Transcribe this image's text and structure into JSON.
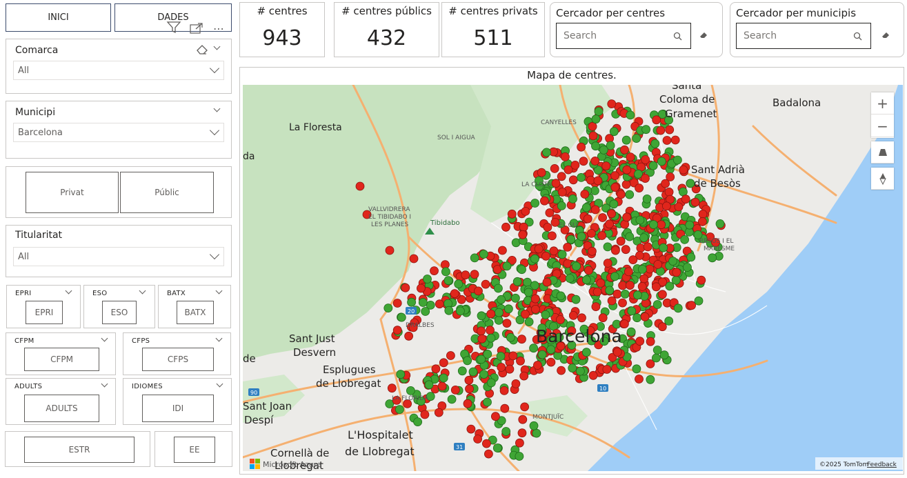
{
  "nav": {
    "inici": "INICI",
    "dades": "DADES"
  },
  "slicers": {
    "comarca": {
      "title": "Comarca",
      "value": "All"
    },
    "municipi": {
      "title": "Municipi",
      "value": "Barcelona"
    },
    "titularitat": {
      "title": "Titularitat",
      "value": "All"
    }
  },
  "tipus_buttons": {
    "privat": "Privat",
    "public": "Públic"
  },
  "levels": [
    {
      "title": "EPRI",
      "button": "EPRI"
    },
    {
      "title": "ESO",
      "button": "ESO"
    },
    {
      "title": "BATX",
      "button": "BATX"
    },
    {
      "title": "CFPM",
      "button": "CFPM"
    },
    {
      "title": "CFPS",
      "button": "CFPS"
    },
    {
      "title": "ADULTS",
      "button": "ADULTS"
    },
    {
      "title": "IDIOMES",
      "button": "IDI"
    },
    {
      "title": "",
      "button": "ESTR"
    },
    {
      "title": "",
      "button": "EE"
    }
  ],
  "kpis": [
    {
      "label": "# centres",
      "value": "943"
    },
    {
      "label": "# centres públics",
      "value": "432"
    },
    {
      "label": "# centres privats",
      "value": "511"
    }
  ],
  "search_centres": {
    "title": "Cercador per centres",
    "placeholder": "Search"
  },
  "search_municipis": {
    "title": "Cercador per municipis",
    "placeholder": "Search"
  },
  "map": {
    "title": "Mapa de centres.",
    "copyright": "©2025 TomTom",
    "feedback": "Feedback",
    "provider": "Microsoft Azure",
    "labels": {
      "santa_coloma_1": "Santa",
      "santa_coloma_2": "Coloma de",
      "santa_coloma_3": "Gramenet",
      "badalona": "Badalona",
      "la_floresta": "La Floresta",
      "sol_i_aigua": "SOL I AIGUA",
      "canyelles": "CANYELLES",
      "la_clota": "LA CLOTA",
      "el_guinardo": "EL GU",
      "sant_adria_1": "Sant Adrià",
      "sant_adria_2": "de Besòs",
      "vallvidrera_1": "VALLVIDRERA",
      "vallvidrera_2": "EL TIBIDABO I",
      "vallvidrera_3": "LES PLANES",
      "tibidabo": "Tibidabo",
      "besos": "BESÒS I EL",
      "maresme": "MARESME",
      "barcelona": "Barcelona",
      "sant_just_1": "Sant Just",
      "sant_just_2": "Desvern",
      "esplugues_1": "Esplugues",
      "esplugues_2": "de Llobregat",
      "la_florida": "LA FLORIDA",
      "sant_joan_1": "Sant Joan",
      "sant_joan_2": "Despí",
      "hospitalet_1": "L'Hospitalet",
      "hospitalet_2": "de Llobregat",
      "cornella_1": "Cornellà de",
      "cornella_2": "Llobregat",
      "montjuic": "MONTJUÏC",
      "pedralbes": "DRALBES",
      "road_20": "20",
      "road_10": "10",
      "road_31": "31",
      "road_90": "90",
      "cut_da": "da",
      "cut_de": "de"
    }
  }
}
